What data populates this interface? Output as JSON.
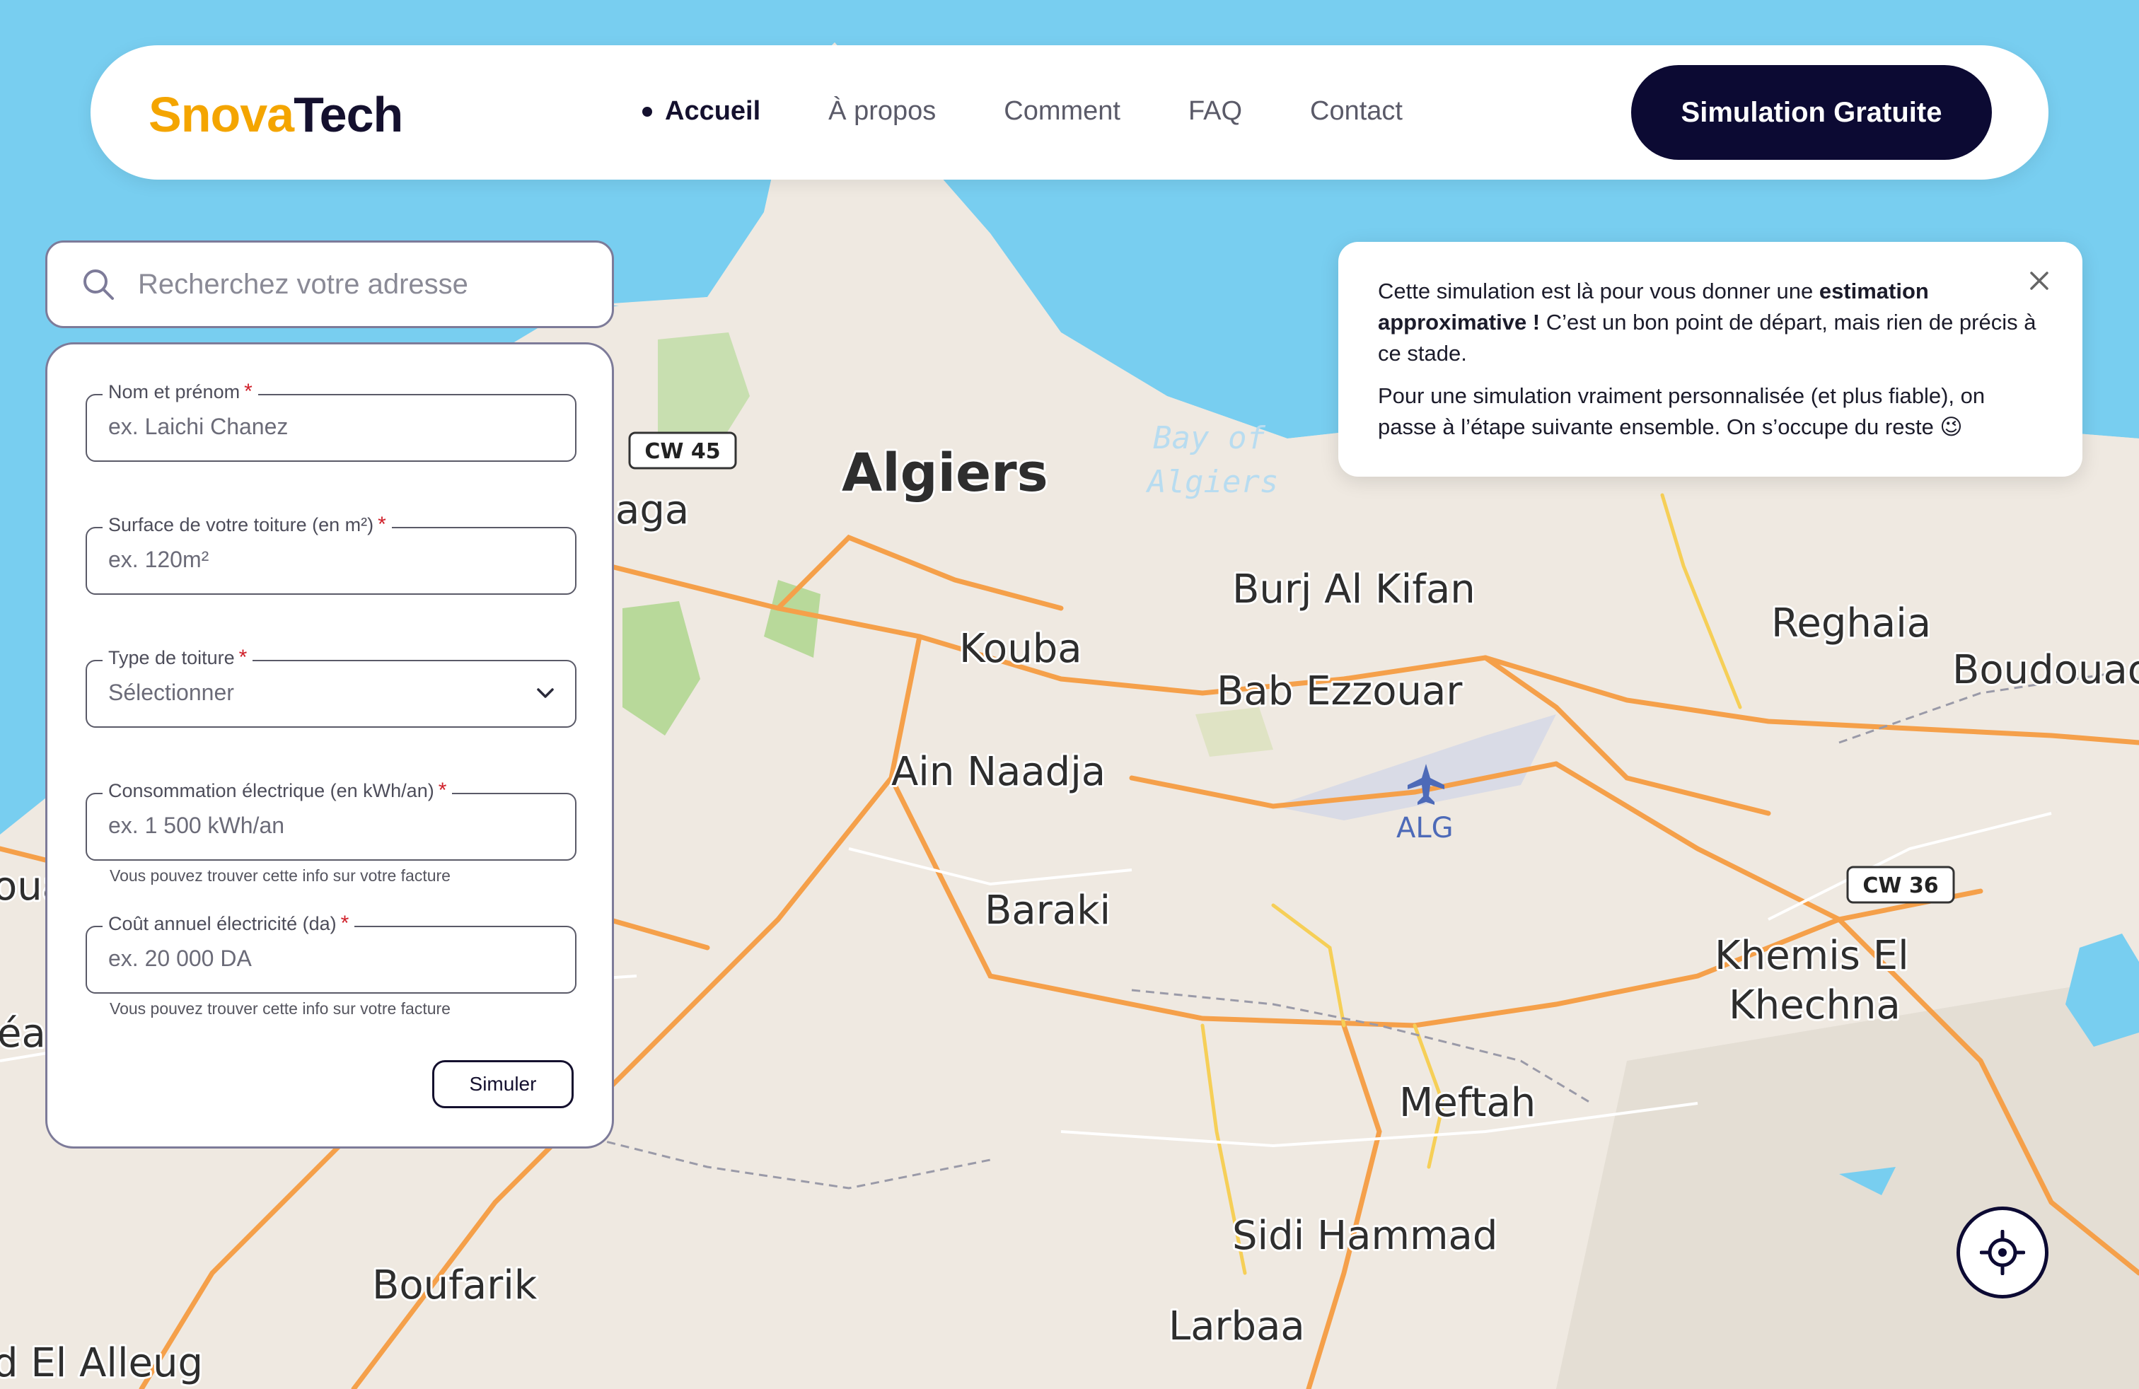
{
  "header": {
    "logo_part1": "Snova",
    "logo_part2": "Tech",
    "nav": [
      "Accueil",
      "À propos",
      "Comment",
      "FAQ",
      "Contact"
    ],
    "active_nav": "Accueil",
    "cta_label": "Simulation Gratuite"
  },
  "search": {
    "placeholder": "Recherchez votre adresse",
    "icon": "search-icon"
  },
  "form": {
    "fields": [
      {
        "label": "Nom et prénom",
        "required": "*",
        "placeholder": "ex. Laichi Chanez"
      },
      {
        "label": "Surface de votre toiture (en m²)",
        "required": "*",
        "placeholder": "ex. 120m²"
      },
      {
        "label": "Type de toiture",
        "required": "*",
        "placeholder": "Sélectionner"
      },
      {
        "label": "Consommation électrique (en kWh/an)",
        "required": "*",
        "placeholder": "ex. 1 500 kWh/an",
        "hint": "Vous pouvez trouver cette info sur votre facture"
      },
      {
        "label": "Coût annuel électricité (da)",
        "required": "*",
        "placeholder": "ex. 20 000 DA",
        "hint": "Vous pouvez trouver cette info sur votre facture"
      }
    ],
    "submit_label": "Simuler"
  },
  "info_box": {
    "p1_before": "Cette simulation est là pour vous donner une ",
    "p1_bold": "estimation approximative !",
    "p1_after": " C’est un bon point de départ, mais rien de précis à ce stade.",
    "p2": "Pour une simulation vraiment personnalisée (et plus fiable), on passe à l’étape suivante ensemble. On s’occupe du reste 😉",
    "close_icon": "close-icon"
  },
  "map": {
    "labels": {
      "algiers": "Algiers",
      "bay1": "Bay of",
      "bay2": "Algiers",
      "burj": "Burj Al Kifan",
      "kouba": "Kouba",
      "bab": "Bab Ezzouar",
      "reghaia": "Reghaia",
      "boudouaou": "Boudouaou",
      "ain": "Ain Naadja",
      "alg": "ALG",
      "baraki": "Baraki",
      "khemis1": "Khemis El",
      "khemis2": "Khechna",
      "meftah": "Meftah",
      "sidi": "Sidi Hammad",
      "boufarik": "Boufarik",
      "larbaa": "Larbaa",
      "elalleug": "d El Alleug",
      "staoueli": "aga",
      "oua": "oua",
      "ea": "éa"
    },
    "shields": {
      "cw45": "CW 45",
      "cw36": "CW 36"
    },
    "colors": {
      "sea": "#78cef0",
      "land": "#efe9e1",
      "road_major": "#f5a04a",
      "road_minor": "#f6cf57"
    },
    "locate_icon": "crosshair-icon"
  }
}
